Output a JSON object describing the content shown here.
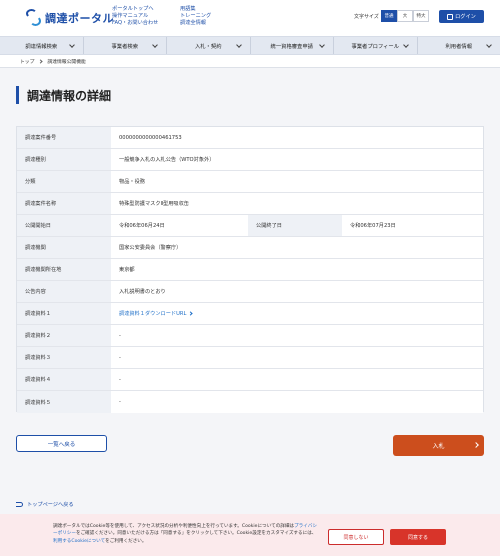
{
  "header": {
    "logo_text": "調達ポータル",
    "links_col1": [
      "ポータルトップへ",
      "操作マニュアル",
      "FAQ・お問い合わせ"
    ],
    "links_col2": [
      "用語集",
      "トレーニング",
      "調達全情報"
    ],
    "font_size_label": "文字サイズ",
    "font_sizes": [
      "普通",
      "大",
      "特大"
    ],
    "font_size_selected": "普通",
    "login_label": "ログイン"
  },
  "nav": {
    "items": [
      "調達情報検索",
      "事業者検索",
      "入札・契約",
      "統一資格審査申請",
      "事業者プロフィール",
      "利用者情報"
    ]
  },
  "breadcrumb": {
    "items": [
      "トップ",
      "調達情報公開機能"
    ]
  },
  "page_title": "調達情報の詳細",
  "details": {
    "rows": [
      {
        "label": "調達案件番号",
        "value": "0000000000000461753"
      },
      {
        "label": "調達種別",
        "value": "一般競争入札の入札公告（WTO対象外）"
      },
      {
        "label": "分類",
        "value": "物品・役務"
      },
      {
        "label": "調達案件名称",
        "value": "特殊型防護マスクⅡ型用吸収缶"
      },
      {
        "label": "調達機関",
        "value": "国家公安委員会（警察庁）"
      },
      {
        "label": "調達機関所在地",
        "value": "東京都"
      },
      {
        "label": "公告内容",
        "value": "入札説明書のとおり"
      },
      {
        "label": "調達資料１",
        "value": "調達資料１ダウンロードURL"
      },
      {
        "label": "調達資料２",
        "value": "-"
      },
      {
        "label": "調達資料３",
        "value": "-"
      },
      {
        "label": "調達資料４",
        "value": "-"
      },
      {
        "label": "調達資料５",
        "value": "-"
      }
    ],
    "start_label": "公開開始日",
    "start_value": "令和06年06月24日",
    "end_label": "公開終了日",
    "end_value": "令和06年07月23日"
  },
  "buttons": {
    "back": "一覧へ戻る",
    "bid": "入札"
  },
  "top_link": "トップページへ戻る",
  "cookie": {
    "text_1": "調達ポータルではCookie等を使用して、アクセス状況の分析や利便性向上を行っています。Cookieについての詳細は",
    "privacy_link": "プライバシーポリシー",
    "text_2": "をご確認ください。同意いただける方は「同意する」をクリックして下さい。Cookie設定をカスタマイズするには、",
    "cookie_link": "利用するCookieについて",
    "text_3": "をご利用ください。",
    "deny": "同意しない",
    "agree": "同意する"
  },
  "colors": {
    "brand": "#1e4fa8",
    "bid_button": "#cc4e1d",
    "cookie_bg": "#fbeaec",
    "cookie_agree": "#d8342a"
  }
}
